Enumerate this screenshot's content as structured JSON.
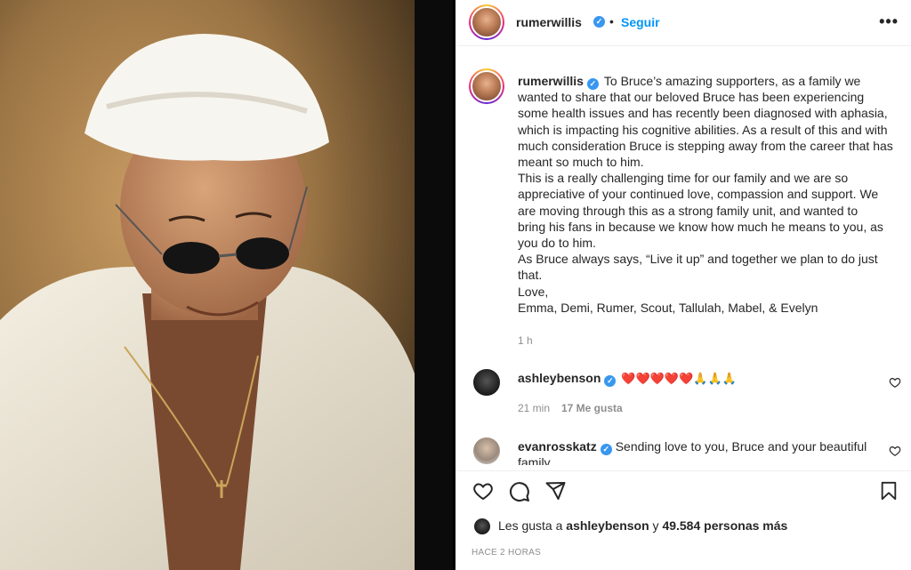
{
  "post": {
    "author": "rumerwillis",
    "follow_label": "Seguir",
    "separator": "•",
    "more_label": "•••",
    "caption_user": "rumerwillis",
    "caption_text": "To Bruce’s amazing supporters, as a family we\nwanted to share that our beloved Bruce has been experiencing\nsome health issues and has recently been diagnosed with aphasia,\nwhich is impacting his cognitive abilities. As a result of this and with\nmuch consideration Bruce is stepping away from the career that has\nmeant so much to him.\nThis is a really challenging time for our family and we are so\nappreciative of your continued love, compassion and support. We\nare moving through this as a strong family unit, and wanted to\nbring his fans in because we know how much he means to you, as\nyou do to him.\nAs Bruce always says, “Live it up” and together we plan to do just\nthat.\nLove,\nEmma, Demi, Rumer, Scout, Tallulah, Mabel, & Evelyn",
    "caption_time": "1 h"
  },
  "comments": [
    {
      "user": "ashleybenson",
      "text": "❤️❤️❤️❤️❤️🙏🙏🙏",
      "time": "21 min",
      "likes": "17 Me gusta"
    },
    {
      "user": "evanrosskatz",
      "text": "Sending love to you, Bruce and your beautiful",
      "text2": "family"
    }
  ],
  "footer": {
    "liked_prefix": "Les gusta a ",
    "liked_user": "ashleybenson",
    "liked_middle": " y ",
    "liked_count": "49.584 personas más",
    "posted_ago": "HACE 2 HORAS"
  },
  "colors": {
    "link_blue": "#0095f6",
    "verified_blue": "#3897f0",
    "heart_red": "#ed4956",
    "muted": "#8e8e8e"
  },
  "icons": {
    "like": "heart-icon",
    "comment": "comment-icon",
    "share": "paper-plane-icon",
    "save": "bookmark-icon",
    "verified": "verified-badge-icon",
    "options": "more-options-icon"
  }
}
